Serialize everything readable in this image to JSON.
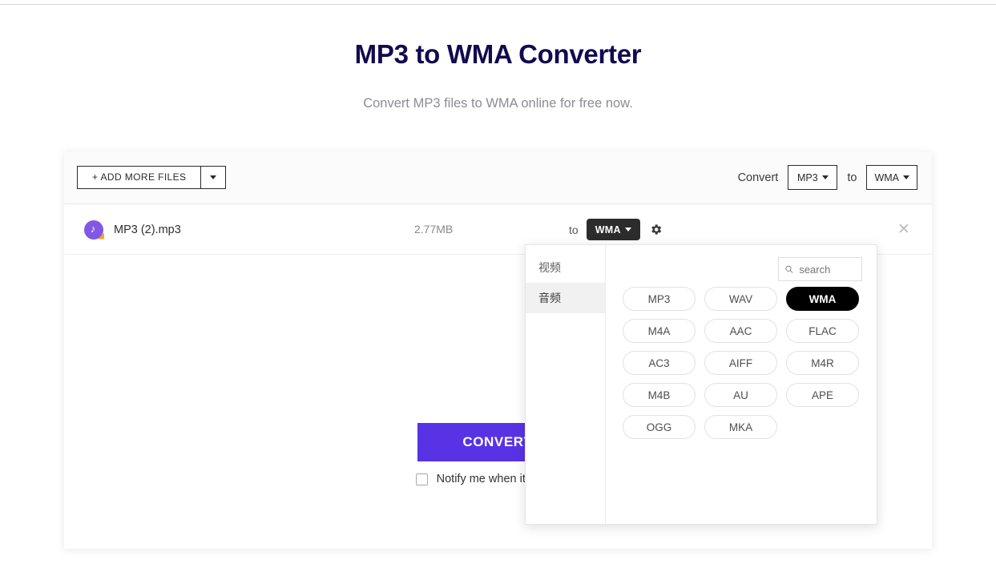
{
  "header": {
    "title": "MP3 to WMA Converter",
    "subtitle": "Convert MP3 files to WMA online for free now."
  },
  "toolbar": {
    "add_more_files_label": "+ ADD MORE FILES",
    "add_more_caret_icon": "chevron-down-icon",
    "convert_label": "Convert",
    "source_format": "MP3",
    "to_label": "to",
    "target_format": "WMA"
  },
  "file_row": {
    "icon": "audio-file-icon",
    "name": "MP3 (2).mp3",
    "size": "2.77MB",
    "to_label": "to",
    "target_format": "WMA",
    "settings_icon": "gear-icon",
    "remove_icon": "close-icon"
  },
  "actions": {
    "convert_button_label": "CONVERT",
    "convert_button_color": "#5833e5",
    "notify_checkbox_label": "Notify me when it is finished",
    "notify_checked": false
  },
  "format_panel": {
    "categories": [
      {
        "label": "视频",
        "active": false
      },
      {
        "label": "音频",
        "active": true
      }
    ],
    "search": {
      "icon": "search-icon",
      "value": "",
      "placeholder": "search"
    },
    "formats": [
      {
        "label": "MP3",
        "selected": false
      },
      {
        "label": "WAV",
        "selected": false
      },
      {
        "label": "WMA",
        "selected": true
      },
      {
        "label": "M4A",
        "selected": false
      },
      {
        "label": "AAC",
        "selected": false
      },
      {
        "label": "FLAC",
        "selected": false
      },
      {
        "label": "AC3",
        "selected": false
      },
      {
        "label": "AIFF",
        "selected": false
      },
      {
        "label": "M4R",
        "selected": false
      },
      {
        "label": "M4B",
        "selected": false
      },
      {
        "label": "AU",
        "selected": false
      },
      {
        "label": "APE",
        "selected": false
      },
      {
        "label": "OGG",
        "selected": false
      },
      {
        "label": "MKA",
        "selected": false
      }
    ]
  }
}
